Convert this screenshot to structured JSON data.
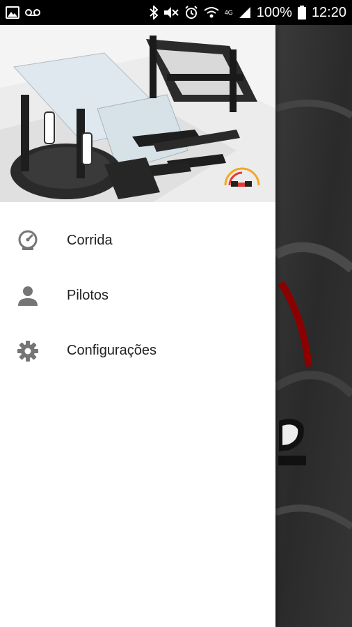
{
  "status_bar": {
    "battery_percent": "100%",
    "time": "12:20",
    "network_type": "4G",
    "icons": [
      "image-icon",
      "voicemail-icon",
      "bluetooth-icon",
      "mute-icon",
      "alarm-icon",
      "wifi-icon",
      "signal-icon",
      "battery-icon"
    ]
  },
  "drawer": {
    "menu": [
      {
        "label": "Corrida",
        "icon": "speedometer-icon"
      },
      {
        "label": "Pilotos",
        "icon": "person-icon"
      },
      {
        "label": "Configurações",
        "icon": "gear-icon"
      }
    ]
  },
  "colors": {
    "drawer_bg": "#ffffff",
    "menu_text": "#212121",
    "menu_icon": "#757575",
    "status_bar_bg": "#000000",
    "background_accent": "#8b0000"
  }
}
